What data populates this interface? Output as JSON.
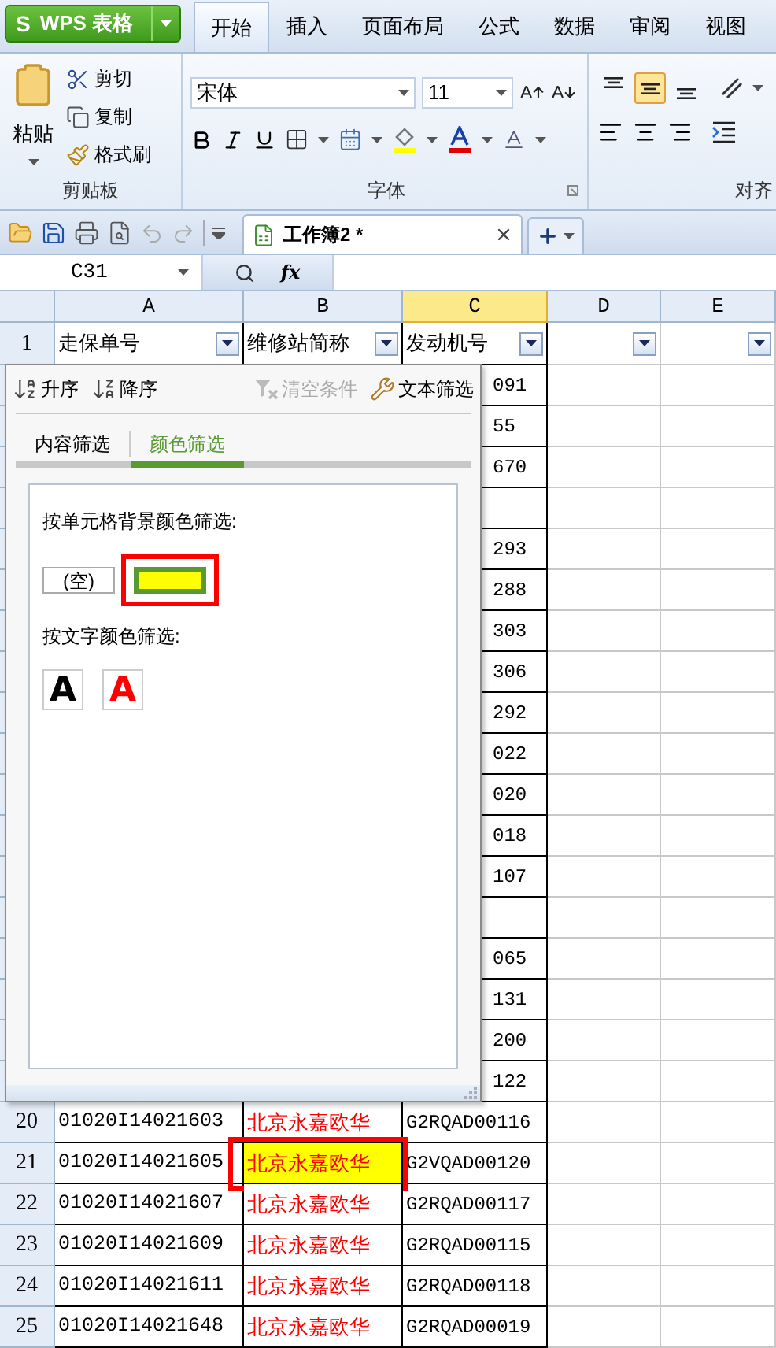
{
  "app_button": {
    "logo": "S",
    "label": "WPS 表格"
  },
  "ribbon_tabs": [
    {
      "label": "开始",
      "selected": true
    },
    {
      "label": "插入",
      "selected": false
    },
    {
      "label": "页面布局",
      "selected": false
    },
    {
      "label": "公式",
      "selected": false
    },
    {
      "label": "数据",
      "selected": false
    },
    {
      "label": "审阅",
      "selected": false
    },
    {
      "label": "视图",
      "selected": false
    }
  ],
  "clipboard_group": {
    "label": "剪贴板",
    "paste": "粘贴",
    "items": [
      {
        "kind": "cut",
        "label": "剪切"
      },
      {
        "kind": "copy",
        "label": "复制"
      },
      {
        "kind": "format",
        "label": "格式刷"
      }
    ]
  },
  "font_group": {
    "label": "字体",
    "font_name": "宋体",
    "font_size": "11"
  },
  "align_group": {
    "label": "对齐",
    "vertical": [
      {
        "kind": "top",
        "selected": false
      },
      {
        "kind": "middle",
        "selected": true
      },
      {
        "kind": "bottom",
        "selected": false
      }
    ]
  },
  "document_tab": {
    "title": "工作簿2 *"
  },
  "formula_bar": {
    "name_box": "C31",
    "fx": "fx"
  },
  "columns": [
    {
      "label": "A",
      "selected": false
    },
    {
      "label": "B",
      "selected": false
    },
    {
      "label": "C",
      "selected": true
    },
    {
      "label": "D",
      "selected": false
    },
    {
      "label": "E",
      "selected": false
    }
  ],
  "header_row": {
    "number": "1",
    "cells": [
      {
        "label": "走保单号",
        "filter": true
      },
      {
        "label": "维修站简称",
        "filter": true
      },
      {
        "label": "发动机号",
        "filter": true
      },
      {
        "filter": true
      },
      {
        "filter": true
      }
    ]
  },
  "rows": [
    {
      "kind": "covered",
      "c": "091"
    },
    {
      "kind": "covered",
      "c": "55"
    },
    {
      "kind": "covered",
      "c": "670"
    },
    {
      "kind": "covered"
    },
    {
      "kind": "covered",
      "c": "293"
    },
    {
      "kind": "covered",
      "c": "288"
    },
    {
      "kind": "covered",
      "c": "303"
    },
    {
      "kind": "covered",
      "c": "306"
    },
    {
      "kind": "covered",
      "c": "292"
    },
    {
      "kind": "covered",
      "c": "022"
    },
    {
      "kind": "covered",
      "c": "020"
    },
    {
      "kind": "covered",
      "c": "018"
    },
    {
      "kind": "covered",
      "c": "107"
    },
    {
      "kind": "covered"
    },
    {
      "kind": "covered",
      "c": "065"
    },
    {
      "kind": "covered",
      "c": "131"
    },
    {
      "kind": "covered",
      "c": "200"
    },
    {
      "kind": "covered",
      "c": "122"
    },
    {
      "kind": "data",
      "number": "20",
      "a": "01020I14021603",
      "b": {
        "text": "北京永嘉欧华",
        "color": "#ff0000",
        "highlighted": false,
        "annotated": false
      },
      "c": "G2RQAD00116"
    },
    {
      "kind": "data",
      "number": "21",
      "a": "01020I14021605",
      "b": {
        "text": "北京永嘉欧华",
        "color": "#ff0000",
        "highlighted": true,
        "annotated": true
      },
      "c": "G2VQAD00120"
    },
    {
      "kind": "data",
      "number": "22",
      "a": "01020I14021607",
      "b": {
        "text": "北京永嘉欧华",
        "color": "#ff0000",
        "highlighted": false,
        "annotated": false
      },
      "c": "G2RQAD00117"
    },
    {
      "kind": "data",
      "number": "23",
      "a": "01020I14021609",
      "b": {
        "text": "北京永嘉欧华",
        "color": "#ff0000",
        "highlighted": false,
        "annotated": false
      },
      "c": "G2RQAD00115"
    },
    {
      "kind": "data",
      "number": "24",
      "a": "01020I14021611",
      "b": {
        "text": "北京永嘉欧华",
        "color": "#ff0000",
        "highlighted": false,
        "annotated": false
      },
      "c": "G2RQAD00118"
    },
    {
      "kind": "data",
      "number": "25",
      "a": "01020I14021648",
      "b": {
        "text": "北京永嘉欧华",
        "color": "#ff0000",
        "highlighted": false,
        "annotated": false
      },
      "c": "G2RQAD00019"
    }
  ],
  "filter_popup": {
    "actions": [
      {
        "kind": "asc",
        "label": "升序",
        "disabled": false
      },
      {
        "kind": "desc",
        "label": "降序",
        "disabled": false
      },
      {
        "kind": "clear",
        "label": "清空条件",
        "disabled": true
      },
      {
        "kind": "text",
        "label": "文本筛选",
        "disabled": false
      }
    ],
    "tabs": [
      {
        "label": "内容筛选",
        "selected": false
      },
      {
        "label": "颜色筛选",
        "selected": true
      }
    ],
    "background_section": {
      "label": "按单元格背景颜色筛选:",
      "options": [
        {
          "kind": "empty",
          "label": "(空)",
          "annotated": false
        },
        {
          "kind": "color",
          "color": "#ffff00",
          "annotated": true
        }
      ]
    },
    "text_section": {
      "label": "按文字颜色筛选:",
      "options": [
        {
          "glyph": "A",
          "color": "#000000"
        },
        {
          "glyph": "A",
          "color": "#ff0000"
        }
      ]
    }
  }
}
